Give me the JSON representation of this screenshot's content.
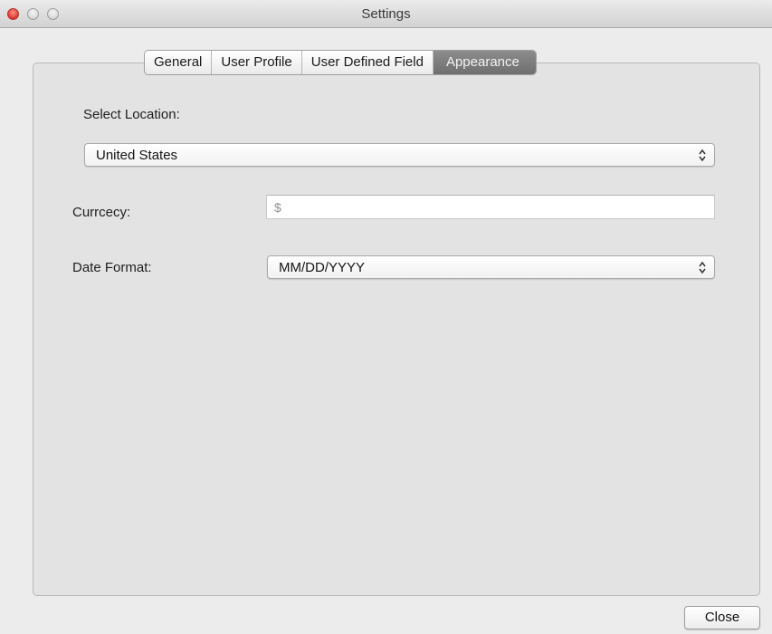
{
  "window": {
    "title": "Settings"
  },
  "tabs": [
    {
      "label": "General",
      "selected": false
    },
    {
      "label": "User Profile",
      "selected": false
    },
    {
      "label": "User Defined Field",
      "selected": false
    },
    {
      "label": "Appearance",
      "selected": true
    }
  ],
  "form": {
    "location_label": "Select Location:",
    "location_value": "United States",
    "currency_label": "Currcecy:",
    "currency_value": "$",
    "date_format_label": "Date Format:",
    "date_format_value": "MM/DD/YYYY"
  },
  "footer": {
    "close_label": "Close"
  },
  "icons": {
    "window_close": "close-dot",
    "window_minimize": "minimize-dot",
    "window_zoom": "zoom-dot",
    "popup_arrows": "updown-chevron-icon"
  },
  "colors": {
    "close_dot": "#e0443a",
    "selected_tab": "#7c7c7c",
    "panel_bg": "#e3e3e3"
  }
}
